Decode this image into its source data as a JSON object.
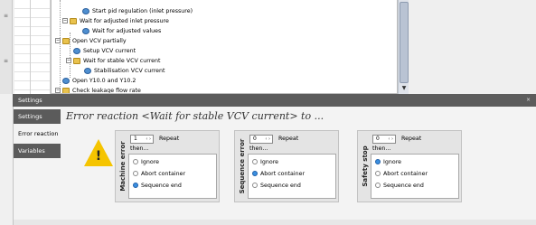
{
  "tree": {
    "items": [
      {
        "label": "Start pid regulation (inlet pressure)",
        "icon": "gear-icon",
        "level": 3
      },
      {
        "label": "Wait for adjusted inlet pressure",
        "icon": "folder-icon",
        "level": 2
      },
      {
        "label": "Wait for adjusted values",
        "icon": "gear-icon",
        "level": 3
      },
      {
        "label": "Open VCV partially",
        "icon": "folder-icon",
        "level": 1
      },
      {
        "label": "Setup VCV current",
        "icon": "gear-icon",
        "level": 2
      },
      {
        "label": "Wait for stable VCV current",
        "icon": "folder-icon",
        "level": 2
      },
      {
        "label": "Stabilisation VCV current",
        "icon": "gear-icon",
        "level": 3
      },
      {
        "label": "Open Y10.0 and Y10.2",
        "icon": "gear-icon",
        "level": 1
      },
      {
        "label": "Check leakage flow rate",
        "icon": "folder-icon",
        "level": 1
      }
    ]
  },
  "settings": {
    "title": "Settings",
    "close_glyph": "×",
    "nav": [
      {
        "label": "Settings"
      },
      {
        "label": "Error reaction"
      },
      {
        "label": "Variables"
      }
    ],
    "heading": "Error reaction <Wait for stable VCV current> to ...",
    "warning_glyph": "!",
    "then_label": "then...",
    "repeat_label": "Repeat",
    "stepper_arrows": "‹ ›",
    "groups": [
      {
        "label": "Machine error",
        "repeat_value": "1",
        "options": [
          {
            "label": "Ignore",
            "selected": false
          },
          {
            "label": "Abort container",
            "selected": false
          },
          {
            "label": "Sequence end",
            "selected": true
          }
        ]
      },
      {
        "label": "Sequence error",
        "repeat_value": "0",
        "options": [
          {
            "label": "Ignore",
            "selected": false
          },
          {
            "label": "Abort container",
            "selected": true
          },
          {
            "label": "Sequence end",
            "selected": false
          }
        ]
      },
      {
        "label": "Safety stop",
        "repeat_value": "0",
        "options": [
          {
            "label": "Ignore",
            "selected": true
          },
          {
            "label": "Abort container",
            "selected": false
          },
          {
            "label": "Sequence end",
            "selected": false
          }
        ]
      }
    ]
  },
  "colors": {
    "warning": "#f5c400",
    "radio_selected": "#3b8fe0",
    "nav_active": "#5b5b5b"
  }
}
